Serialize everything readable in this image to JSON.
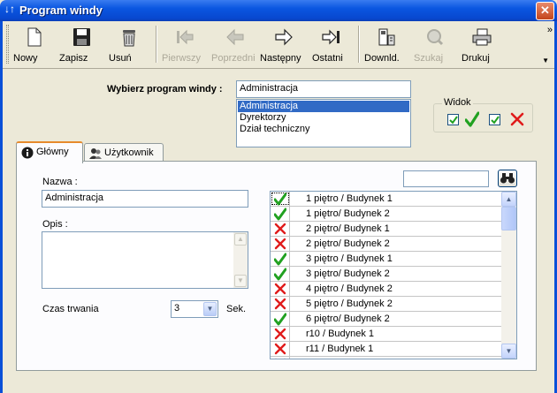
{
  "window": {
    "title": "Program windy",
    "title_icon": "↓↑",
    "close_glyph": "✕"
  },
  "toolbar": {
    "buttons": [
      {
        "label": "Nowy",
        "icon": "new-document-icon",
        "enabled": true
      },
      {
        "label": "Zapisz",
        "icon": "floppy-disk-icon",
        "enabled": true
      },
      {
        "label": "Usuń",
        "icon": "trash-bin-icon",
        "enabled": true
      },
      {
        "label": "Pierwszy",
        "icon": "first-record-icon",
        "enabled": false
      },
      {
        "label": "Poprzedni",
        "icon": "previous-arrow-icon",
        "enabled": false
      },
      {
        "label": "Następny",
        "icon": "next-arrow-icon",
        "enabled": true
      },
      {
        "label": "Ostatni",
        "icon": "last-record-icon",
        "enabled": true
      },
      {
        "label": "Downld.",
        "icon": "download-device-icon",
        "enabled": true
      },
      {
        "label": "Szukaj",
        "icon": "search-icon",
        "enabled": false
      },
      {
        "label": "Drukuj",
        "icon": "printer-icon",
        "enabled": true
      }
    ],
    "overflow_glyph": "»",
    "overflow_menu_glyph": "▼"
  },
  "program": {
    "label": "Wybierz program windy :",
    "value": "Administracja",
    "options": [
      "Administracja",
      "Dyrektorzy",
      "Dział techniczny"
    ],
    "selected_index": 0
  },
  "widok": {
    "title": "Widok",
    "show_allowed": true,
    "show_denied": true,
    "accent_green": "#21a121",
    "accent_red": "#e01b1b"
  },
  "tabs": [
    {
      "label": "Główny",
      "icon": "info-icon",
      "active": true
    },
    {
      "label": "Użytkownik",
      "icon": "users-icon",
      "active": false
    }
  ],
  "form": {
    "nazwa_label": "Nazwa :",
    "nazwa_value": "Administracja",
    "opis_label": "Opis :",
    "opis_value": "",
    "czas_label": "Czas trwania",
    "czas_value": "3",
    "czas_unit": "Sek.",
    "search_value": ""
  },
  "floors": [
    {
      "name": "1 piętro / Budynek 1",
      "allowed": true
    },
    {
      "name": "1 piętro/ Budynek 2",
      "allowed": true
    },
    {
      "name": "2 piętro/ Budynek 1",
      "allowed": false
    },
    {
      "name": "2 piętro/ Budynek 2",
      "allowed": false
    },
    {
      "name": "3 piętro / Budynek 1",
      "allowed": true
    },
    {
      "name": "3 piętro/ Budynek 2",
      "allowed": true
    },
    {
      "name": "4 piętro / Budynek 2",
      "allowed": false
    },
    {
      "name": "5 piętro / Budynek 2",
      "allowed": false
    },
    {
      "name": "6 piętro/ Budynek 2",
      "allowed": true
    },
    {
      "name": "r10 / Budynek 1",
      "allowed": false
    },
    {
      "name": "r11 / Budynek 1",
      "allowed": false
    },
    {
      "name": "",
      "allowed": false
    }
  ]
}
